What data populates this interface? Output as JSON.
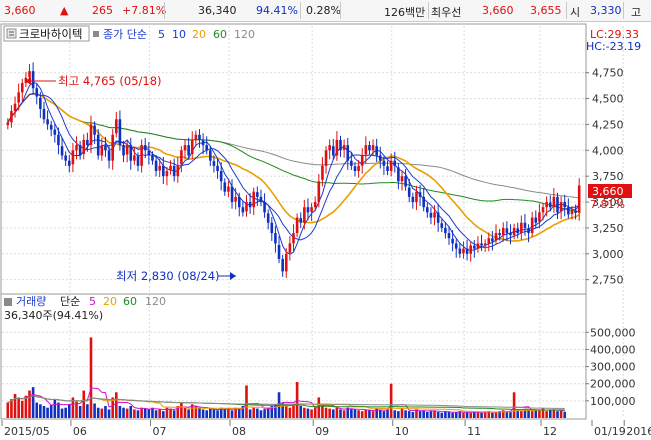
{
  "quote_bar": {
    "price": "3,660",
    "change_arrow": "▲",
    "change": "265",
    "change_pct": "+7.81%",
    "volume": "36,340",
    "volume_ratio": "94.41%",
    "turnover_pct": "0.28%",
    "amount": "126백만",
    "best_bid_label": "최우선",
    "best_ask": "3,660",
    "best_bid": "3,655",
    "open_label": "시",
    "open": "3,330",
    "high_label": "고"
  },
  "price_panel": {
    "tab_label": "크로바하이텍",
    "ma_label": "종가 단순",
    "ma_periods": [
      "5",
      "10",
      "20",
      "60",
      "120"
    ],
    "ma_colors": [
      "#1a3cd0",
      "#1a3cd0",
      "#e8a000",
      "#208a20",
      "#8a8a8a"
    ],
    "lc_label": "LC:29.33",
    "hc_label": "HC:-23.19",
    "max_annotation": "최고 4,765 (05/18)",
    "min_annotation": "최저 2,830 (08/24)",
    "current_price_badge": "3,660",
    "current_change_badge": "7.81%"
  },
  "volume_panel": {
    "tab_label": "거래량",
    "ma_label": "단순",
    "ma_periods": [
      "5",
      "20",
      "60",
      "120"
    ],
    "ma_colors": [
      "#d010d0",
      "#e8a000",
      "#208a20",
      "#8a8a8a"
    ],
    "current_volume": "36,340주(94.41%)"
  },
  "x_axis_labels": [
    "2015/05",
    "06",
    "07",
    "08",
    "09",
    "10",
    "11",
    "12",
    "2016/01",
    "01/19"
  ],
  "colors": {
    "up": "#e01010",
    "down": "#1030c0",
    "grid": "#dcdcdc",
    "badge_red": "#e01010",
    "badge_blue": "#1030c0"
  },
  "chart_data": {
    "type": "candlestick",
    "price_axis": {
      "ticks": [
        2750,
        3000,
        3250,
        3500,
        3750,
        4000,
        4250,
        4500,
        4750
      ],
      "ylim": [
        2650,
        4950
      ]
    },
    "volume_axis": {
      "ticks": [
        100000,
        200000,
        300000,
        400000,
        500000
      ],
      "ylim": [
        0,
        560000
      ]
    },
    "close_series": [
      4270,
      4380,
      4450,
      4560,
      4650,
      4700,
      4765,
      4600,
      4520,
      4400,
      4300,
      4250,
      4200,
      4150,
      4050,
      3950,
      3900,
      3850,
      4000,
      4050,
      3950,
      4100,
      4050,
      4250,
      4150,
      3950,
      4050,
      4000,
      3900,
      4150,
      4300,
      4050,
      3950,
      4050,
      3900,
      3950,
      3850,
      4050,
      4000,
      3950,
      3900,
      3800,
      3850,
      3750,
      3800,
      3850,
      3750,
      3850,
      4000,
      4050,
      3950,
      4100,
      4150,
      4100,
      4050,
      4000,
      3900,
      3850,
      3800,
      3700,
      3600,
      3650,
      3500,
      3550,
      3450,
      3400,
      3500,
      3450,
      3600,
      3550,
      3500,
      3400,
      3300,
      3200,
      3100,
      2950,
      2830,
      3000,
      3100,
      3200,
      3350,
      3300,
      3450,
      3400,
      3450,
      3500,
      3700,
      3850,
      4000,
      4050,
      3950,
      4100,
      4000,
      4050,
      3900,
      3850,
      3800,
      3850,
      3950,
      4050,
      4000,
      4050,
      3950,
      3900,
      3850,
      3800,
      3900,
      3850,
      3700,
      3750,
      3650,
      3550,
      3500,
      3600,
      3550,
      3450,
      3400,
      3350,
      3400,
      3300,
      3250,
      3200,
      3150,
      3100,
      3050,
      3000,
      3050,
      3000,
      3080,
      3050,
      3100,
      3080,
      3100,
      3150,
      3120,
      3200,
      3180,
      3250,
      3200,
      3180,
      3250,
      3200,
      3300,
      3250,
      3200,
      3350,
      3300,
      3400,
      3450,
      3500,
      3450,
      3550,
      3400,
      3500,
      3450,
      3380,
      3420,
      3395,
      3660
    ],
    "volume_series": [
      90000,
      110000,
      140000,
      120000,
      100000,
      130000,
      160000,
      180000,
      90000,
      80000,
      70000,
      60000,
      75000,
      110000,
      90000,
      55000,
      60000,
      80000,
      120000,
      95000,
      70000,
      160000,
      80000,
      470000,
      85000,
      60000,
      55000,
      70000,
      50000,
      120000,
      150000,
      70000,
      60000,
      55000,
      70000,
      50000,
      45000,
      60000,
      55000,
      50000,
      60000,
      45000,
      50000,
      40000,
      60000,
      55000,
      45000,
      70000,
      90000,
      60000,
      50000,
      80000,
      70000,
      60000,
      50000,
      45000,
      55000,
      50000,
      45000,
      60000,
      50000,
      55000,
      45000,
      60000,
      50000,
      70000,
      190000,
      50000,
      60000,
      55000,
      45000,
      50000,
      60000,
      70000,
      80000,
      150000,
      90000,
      70000,
      60000,
      80000,
      210000,
      70000,
      60000,
      55000,
      50000,
      60000,
      120000,
      80000,
      60000,
      55000,
      50000,
      60000,
      50000,
      45000,
      60000,
      55000,
      50000,
      45000,
      40000,
      50000,
      45000,
      40000,
      55000,
      45000,
      40000,
      50000,
      200000,
      45000,
      40000,
      55000,
      45000,
      40000,
      35000,
      50000,
      40000,
      45000,
      35000,
      40000,
      45000,
      35000,
      30000,
      40000,
      35000,
      30000,
      35000,
      40000,
      30000,
      35000,
      30000,
      40000,
      35000,
      30000,
      35000,
      40000,
      30000,
      35000,
      40000,
      45000,
      40000,
      35000,
      150000,
      45000,
      40000,
      50000,
      45000,
      40000,
      50000,
      45000,
      55000,
      40000,
      45000,
      50000,
      40000,
      45000,
      36340
    ]
  }
}
